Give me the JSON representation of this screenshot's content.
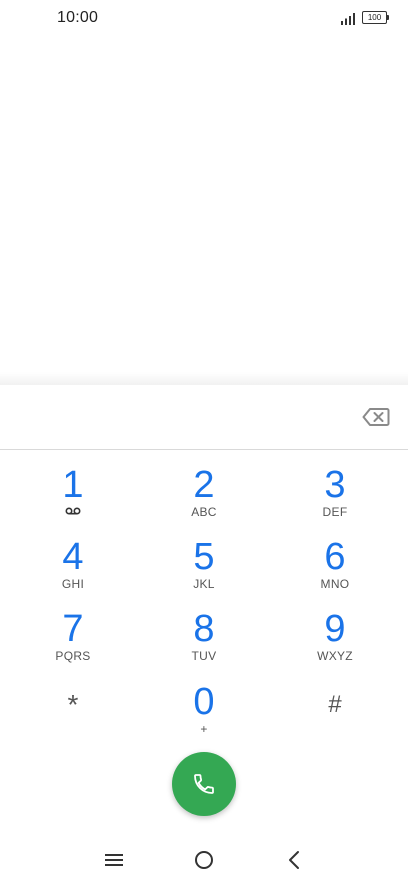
{
  "status_bar": {
    "time": "10:00",
    "battery_level": "100",
    "signal_icon": "signal-bars-icon"
  },
  "dialpad": {
    "backspace_icon": "backspace-icon",
    "keys": [
      {
        "digit": "1",
        "letters": "",
        "sub_icon": "voicemail-icon"
      },
      {
        "digit": "2",
        "letters": "ABC"
      },
      {
        "digit": "3",
        "letters": "DEF"
      },
      {
        "digit": "4",
        "letters": "GHI"
      },
      {
        "digit": "5",
        "letters": "JKL"
      },
      {
        "digit": "6",
        "letters": "MNO"
      },
      {
        "digit": "7",
        "letters": "PQRS"
      },
      {
        "digit": "8",
        "letters": "TUV"
      },
      {
        "digit": "9",
        "letters": "WXYZ"
      },
      {
        "digit": "*",
        "letters": ""
      },
      {
        "digit": "0",
        "letters": "+"
      },
      {
        "digit": "#",
        "letters": ""
      }
    ],
    "call_icon": "phone-icon"
  },
  "colors": {
    "accent": "#1a73e8",
    "call_green": "#34a853",
    "secondary_text": "#555555"
  },
  "nav_bar": {
    "menu_icon": "menu-icon",
    "home_icon": "home-circle-icon",
    "back_icon": "back-chevron-icon"
  }
}
